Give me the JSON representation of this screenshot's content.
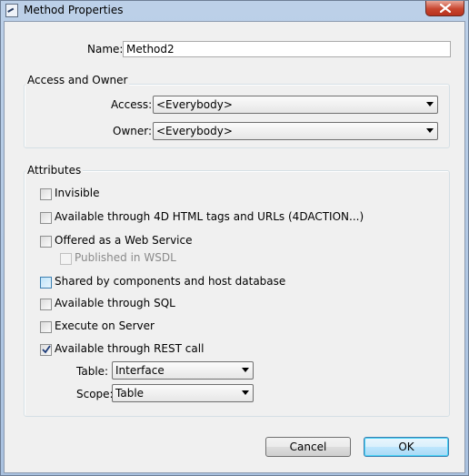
{
  "window": {
    "title": "Method Properties"
  },
  "name_field": {
    "label": "Name:",
    "value": "Method2"
  },
  "access_owner": {
    "title": "Access and Owner",
    "access_label": "Access:",
    "access_value": "<Everybody>",
    "owner_label": "Owner:",
    "owner_value": "<Everybody>"
  },
  "attributes": {
    "title": "Attributes",
    "items": [
      {
        "label": "Invisible",
        "checked": false
      },
      {
        "label": "Available through 4D HTML tags and URLs (4DACTION...)",
        "checked": false
      },
      {
        "label": "Offered as a Web Service",
        "checked": false
      },
      {
        "label": "Published in WSDL",
        "checked": false,
        "disabled": true
      },
      {
        "label": "Shared by components and host database",
        "checked": false
      },
      {
        "label": "Available through SQL",
        "checked": false
      },
      {
        "label": "Execute on Server",
        "checked": false
      },
      {
        "label": "Available through REST call",
        "checked": true
      }
    ],
    "table_label": "Table:",
    "table_value": "Interface",
    "scope_label": "Scope:",
    "scope_value": "Table"
  },
  "buttons": {
    "cancel": "Cancel",
    "ok": "OK"
  }
}
